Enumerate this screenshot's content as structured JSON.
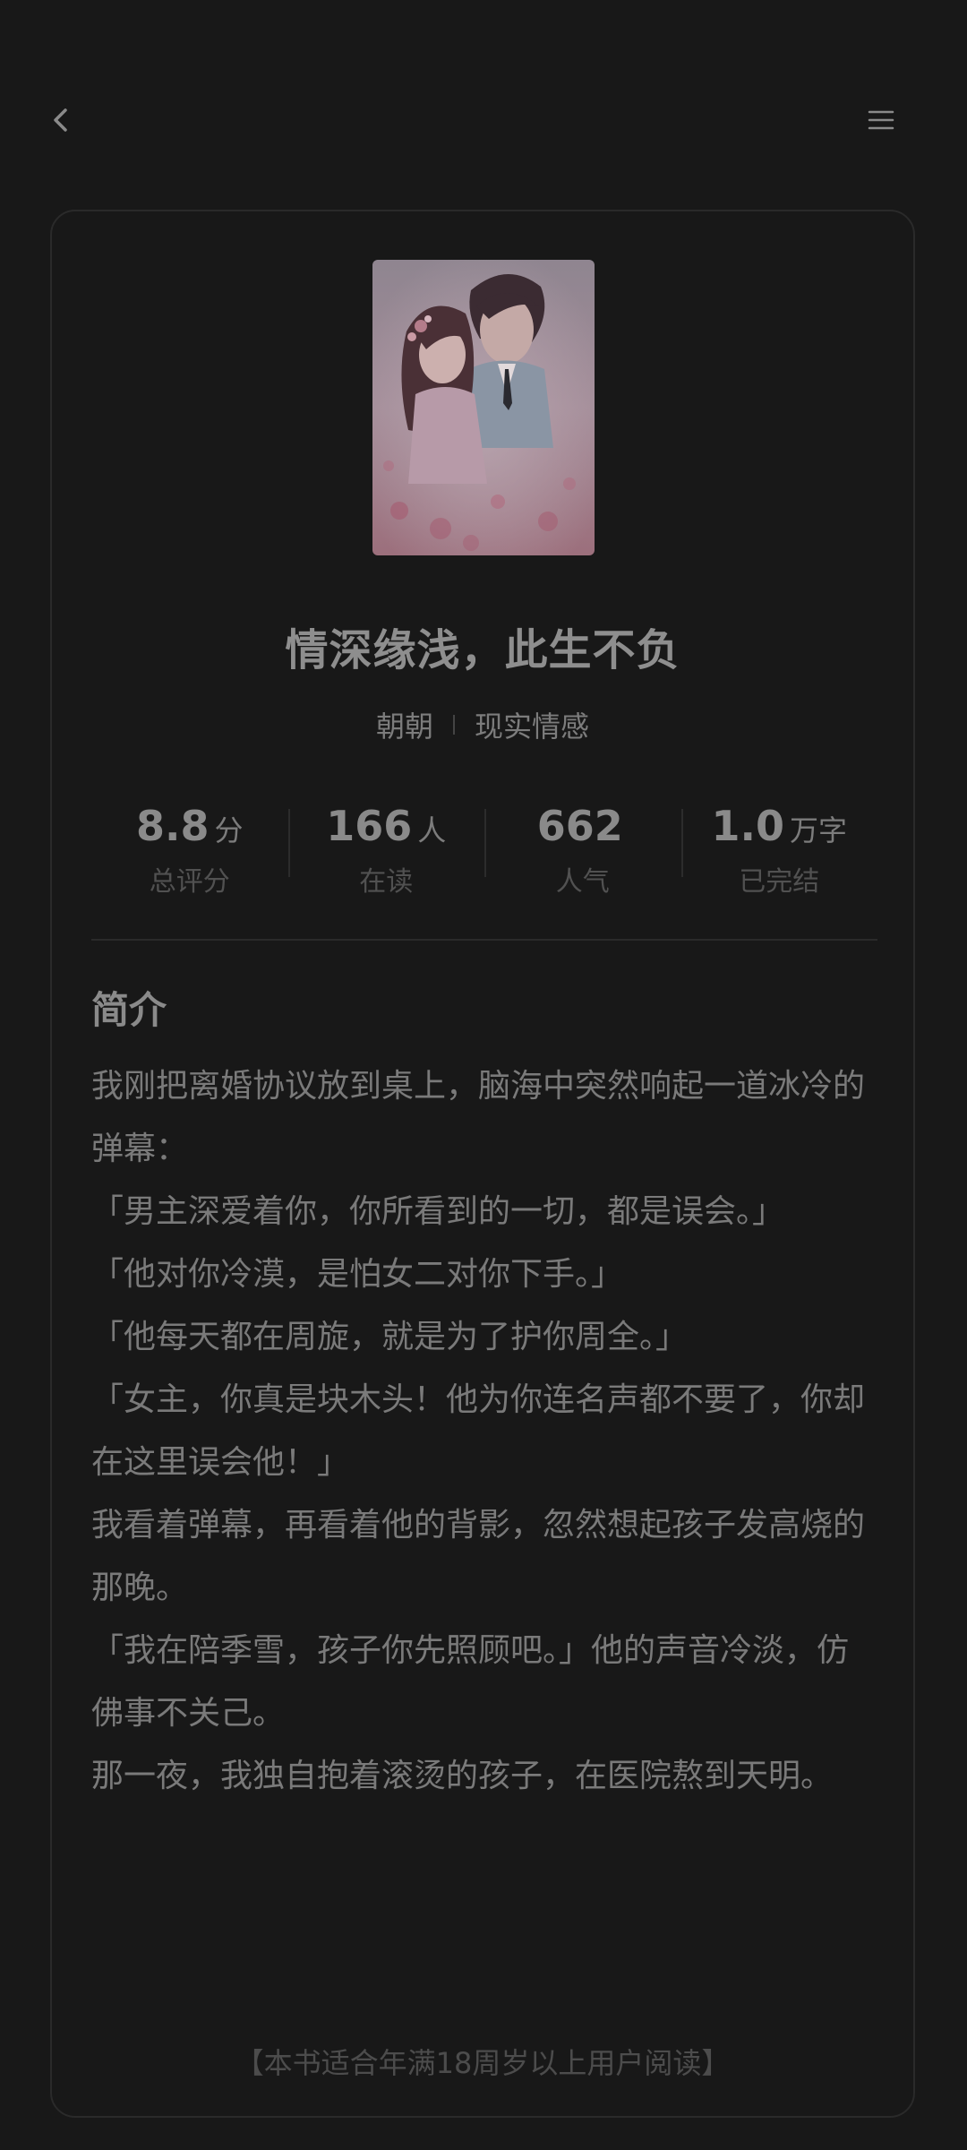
{
  "nav": {
    "back_icon": "chevron-left-icon",
    "menu_icon": "hamburger-menu-icon"
  },
  "book": {
    "title": "情深缘浅，此生不负",
    "author": "朝朝",
    "category": "现实情感",
    "cover_icon": "book-cover-illustration"
  },
  "stats": [
    {
      "value": "8.8",
      "unit": "分",
      "label": "总评分"
    },
    {
      "value": "166",
      "unit": "人",
      "label": "在读"
    },
    {
      "value": "662",
      "unit": "",
      "label": "人气"
    },
    {
      "value": "1.0",
      "unit": "万字",
      "label": "已完结"
    }
  ],
  "intro": {
    "heading": "简介",
    "paragraphs": [
      "我刚把离婚协议放到桌上，脑海中突然响起一道冰冷的弹幕：",
      "「男主深爱着你，你所看到的一切，都是误会。」",
      "「他对你冷漠，是怕女二对你下手。」",
      "「他每天都在周旋，就是为了护你周全。」",
      "「女主，你真是块木头！他为你连名声都不要了，你却在这里误会他！」",
      "我看着弹幕，再看着他的背影，忽然想起孩子发高烧的那晚。",
      "「我在陪季雪，孩子你先照顾吧。」他的声音冷淡，仿佛事不关己。",
      "那一夜，我独自抱着滚烫的孩子，在医院熬到天明。"
    ]
  },
  "notice": "【本书适合年满18周岁以上用户阅读】",
  "colors": {
    "background": "#181818",
    "card_border": "#2a2a2a",
    "text_primary": "#8a8a8a",
    "text_muted": "#515151"
  }
}
